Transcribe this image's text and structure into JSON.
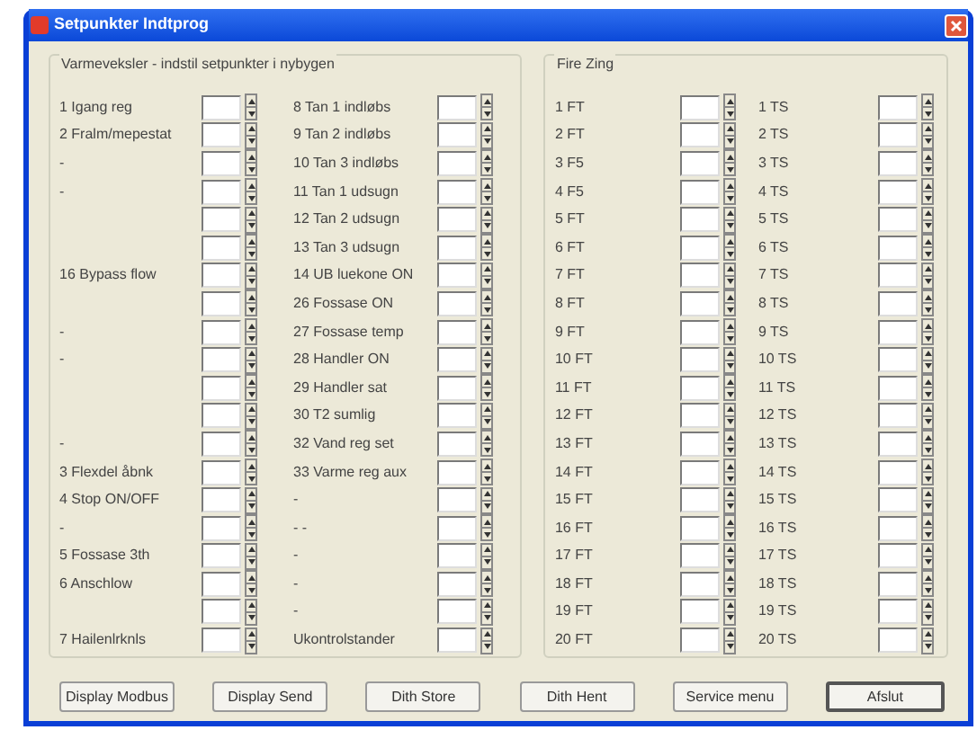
{
  "window": {
    "title": "Setpunkter Indtprog"
  },
  "groups": [
    {
      "title": "Varmeveksler - indstil setpunkter i nybygen",
      "columns": [
        {
          "rows": [
            {
              "label": "1 Igang reg"
            },
            {
              "label": "2 Fralm/mepestat"
            },
            {
              "label": "-"
            },
            {
              "label": "-"
            },
            {
              "label": ""
            },
            {
              "label": ""
            },
            {
              "label": "16 Bypass flow"
            },
            {
              "label": ""
            },
            {
              "label": "-"
            },
            {
              "label": "-"
            },
            {
              "label": ""
            },
            {
              "label": ""
            },
            {
              "label": "-"
            },
            {
              "label": "3 Flexdel åbnk"
            },
            {
              "label": "4 Stop ON/OFF"
            },
            {
              "label": "-"
            },
            {
              "label": "5 Fossase 3th"
            },
            {
              "label": "6 Anschlow"
            },
            {
              "label": ""
            },
            {
              "label": "7 Hailenlrknls"
            }
          ]
        },
        {
          "rows": [
            {
              "label": "8 Tan 1 indløbs"
            },
            {
              "label": "9 Tan 2 indløbs"
            },
            {
              "label": "10 Tan 3 indløbs"
            },
            {
              "label": "11 Tan 1 udsugn"
            },
            {
              "label": "12 Tan 2 udsugn"
            },
            {
              "label": "13 Tan 3 udsugn"
            },
            {
              "label": "14 UB luekone ON"
            },
            {
              "label": "26 Fossase ON"
            },
            {
              "label": "27 Fossase temp"
            },
            {
              "label": "28 Handler ON"
            },
            {
              "label": "29 Handler sat"
            },
            {
              "label": "30 T2 sumlig"
            },
            {
              "label": "32 Vand reg set"
            },
            {
              "label": "33 Varme reg aux"
            },
            {
              "label": "-"
            },
            {
              "label": "- -"
            },
            {
              "label": "-"
            },
            {
              "label": "-"
            },
            {
              "label": "-"
            },
            {
              "label": "Ukontrolstander"
            }
          ]
        }
      ]
    },
    {
      "title": "Fire Zing",
      "columns": [
        {
          "rows": [
            {
              "label": "1 FT"
            },
            {
              "label": "2 FT"
            },
            {
              "label": "3 F5"
            },
            {
              "label": "4 F5"
            },
            {
              "label": "5 FT"
            },
            {
              "label": "6 FT"
            },
            {
              "label": "7 FT"
            },
            {
              "label": "8 FT"
            },
            {
              "label": "9 FT"
            },
            {
              "label": "10 FT"
            },
            {
              "label": "11 FT"
            },
            {
              "label": "12 FT"
            },
            {
              "label": "13 FT"
            },
            {
              "label": "14 FT"
            },
            {
              "label": "15 FT"
            },
            {
              "label": "16 FT"
            },
            {
              "label": "17 FT"
            },
            {
              "label": "18 FT"
            },
            {
              "label": "19 FT"
            },
            {
              "label": "20 FT"
            }
          ]
        },
        {
          "rows": [
            {
              "label": "1 TS"
            },
            {
              "label": "2 TS"
            },
            {
              "label": "3 TS"
            },
            {
              "label": "4 TS"
            },
            {
              "label": "5 TS"
            },
            {
              "label": "6 TS"
            },
            {
              "label": "7 TS"
            },
            {
              "label": "8 TS"
            },
            {
              "label": "9 TS"
            },
            {
              "label": "10 TS"
            },
            {
              "label": "11 TS"
            },
            {
              "label": "12 TS"
            },
            {
              "label": "13 TS"
            },
            {
              "label": "14 TS"
            },
            {
              "label": "15 TS"
            },
            {
              "label": "16 TS"
            },
            {
              "label": "17 TS"
            },
            {
              "label": "18 TS"
            },
            {
              "label": "19 TS"
            },
            {
              "label": "20 TS"
            }
          ]
        }
      ]
    }
  ],
  "buttons": [
    {
      "label": "Display Modbus",
      "default": false
    },
    {
      "label": "Display Send",
      "default": false
    },
    {
      "label": "Dith Store",
      "default": false
    },
    {
      "label": "Dith Hent",
      "default": false
    },
    {
      "label": "Service menu",
      "default": false
    },
    {
      "label": "Afslut",
      "default": true
    }
  ]
}
